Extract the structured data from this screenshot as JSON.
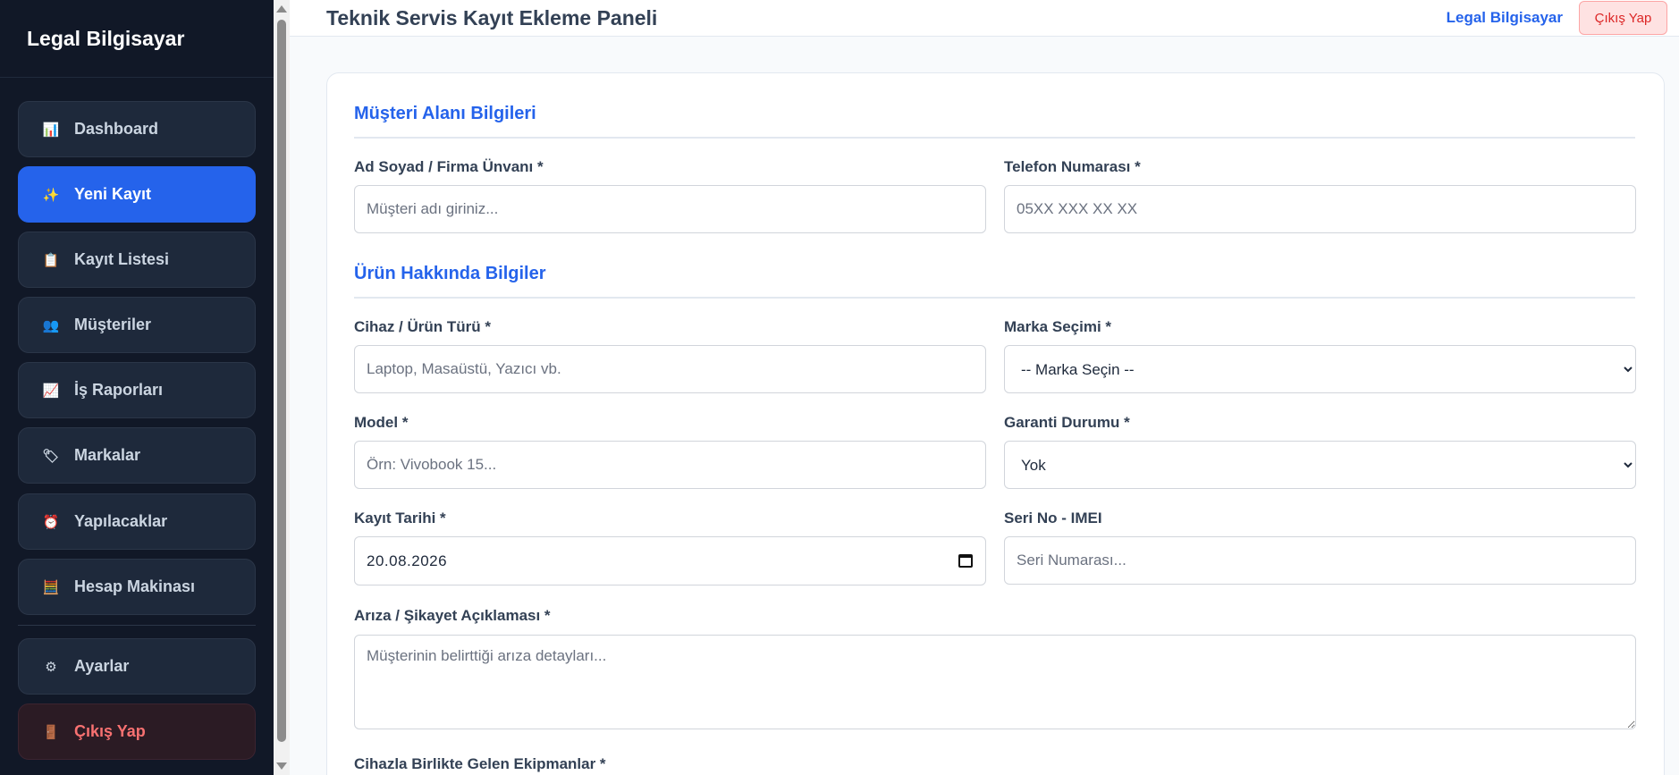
{
  "brand": "Legal Bilgisayar",
  "sidebar": {
    "items": [
      {
        "icon": "📊",
        "icon_name": "chart-icon",
        "label": "Dashboard"
      },
      {
        "icon": "✨",
        "icon_name": "sparkles-icon",
        "label": "Yeni Kayıt"
      },
      {
        "icon": "📋",
        "icon_name": "clipboard-icon",
        "label": "Kayıt Listesi"
      },
      {
        "icon": "👥",
        "icon_name": "users-icon",
        "label": "Müşteriler"
      },
      {
        "icon": "📈",
        "icon_name": "trend-chart-icon",
        "label": "İş Raporları"
      },
      {
        "icon": "🏷",
        "icon_name": "tag-icon",
        "label": "Markalar"
      },
      {
        "icon": "⏰",
        "icon_name": "alarm-clock-icon",
        "label": "Yapılacaklar"
      },
      {
        "icon": "🧮",
        "icon_name": "abacus-icon",
        "label": "Hesap Makinası"
      },
      {
        "icon": "⚙",
        "icon_name": "gear-icon",
        "label": "Ayarlar"
      },
      {
        "icon": "🚪",
        "icon_name": "door-icon",
        "label": "Çıkış Yap"
      }
    ],
    "active_index": 1
  },
  "header": {
    "title": "Teknik Servis Kayıt Ekleme Paneli",
    "user": "Legal Bilgisayar",
    "logout": "Çıkış Yap"
  },
  "form": {
    "section_customer": "Müşteri Alanı Bilgileri",
    "name_label": "Ad Soyad / Firma Ünvanı *",
    "name_placeholder": "Müşteri adı giriniz...",
    "phone_label": "Telefon Numarası *",
    "phone_placeholder": "05XX XXX XX XX",
    "section_product": "Ürün Hakkında Bilgiler",
    "device_label": "Cihaz / Ürün Türü *",
    "device_placeholder": "Laptop, Masaüstü, Yazıcı vb.",
    "brand_label": "Marka Seçimi *",
    "brand_selected": "-- Marka Seçin --",
    "model_label": "Model *",
    "model_placeholder": "Örn: Vivobook 15...",
    "warranty_label": "Garanti Durumu *",
    "warranty_selected": "Yok",
    "date_label": "Kayıt Tarihi *",
    "date_value": "20.08.2026",
    "serial_label": "Seri No - IMEI",
    "serial_placeholder": "Seri Numarası...",
    "complaint_label": "Arıza / Şikayet Açıklaması *",
    "complaint_placeholder": "Müşterinin belirttiği arıza detayları...",
    "equipment_label": "Cihazla Birlikte Gelen Ekipmanlar *"
  },
  "colors": {
    "sidebar_bg": "#111827",
    "accent": "#2563eb",
    "danger": "#dc2626"
  }
}
